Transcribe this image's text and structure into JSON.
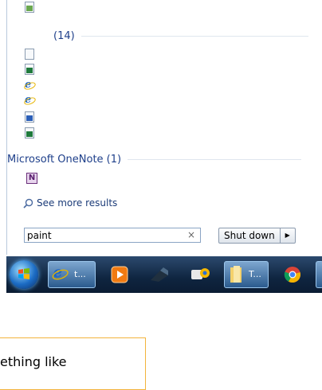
{
  "results": {
    "group_documents_count": "(14)",
    "group_onenote_label": "Microsoft OneNote (1)",
    "onenote_icon_letter": "N",
    "see_more_label": "See more results"
  },
  "search": {
    "value": "paint",
    "clear_glyph": "×"
  },
  "shutdown": {
    "label": "Shut down",
    "arrow": "▶"
  },
  "taskbar": {
    "ie_label": "t...",
    "explorer_label": "T..."
  },
  "callout": {
    "text": "ething like"
  },
  "colors": {
    "group_header": "#1e3f8a",
    "accent_border": "#f3b43c"
  }
}
